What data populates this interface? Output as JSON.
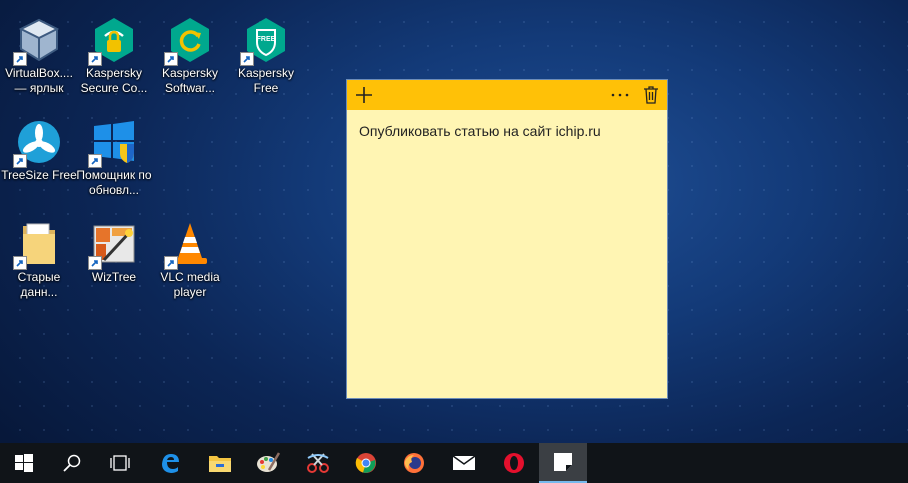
{
  "desktop": {
    "icons": [
      {
        "label": "VirtualBox.... — ярлык"
      },
      {
        "label": "Kaspersky Secure Co..."
      },
      {
        "label": "Kaspersky Softwar..."
      },
      {
        "label": "Kaspersky Free"
      },
      {
        "label": "TreeSize Free"
      },
      {
        "label": "Помощник по обновл..."
      },
      {
        "label": "Старые данн..."
      },
      {
        "label": "WizTree"
      },
      {
        "label": "VLC media player"
      }
    ]
  },
  "sticky_note": {
    "text": "Опубликовать статью на сайт ichip.ru",
    "bar_color": "#ffc107",
    "body_color": "#fff5b3"
  },
  "taskbar": {
    "items": [
      "start-icon",
      "search-icon",
      "task-view-icon",
      "edge-icon",
      "file-explorer-icon",
      "paint-icon",
      "snipping-tool-icon",
      "chrome-icon",
      "firefox-icon",
      "mail-icon",
      "opera-icon",
      "sticky-notes-icon"
    ],
    "active": "sticky-notes-icon"
  }
}
